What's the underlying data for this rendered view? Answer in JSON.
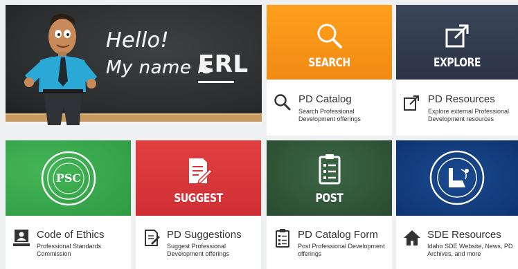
{
  "hero": {
    "line1": "Hello!",
    "line2": "My name is",
    "name": "ERL"
  },
  "tiles": [
    {
      "label": "SEARCH",
      "color": "#f7901e",
      "icon": "magnifier-icon"
    },
    {
      "label": "EXPLORE",
      "color": "#2f3b4e",
      "icon": "external-link-icon"
    },
    {
      "label": "",
      "color": "#37a64a",
      "icon": "psc-seal-icon",
      "seal_text": "PSC"
    },
    {
      "label": "SUGGEST",
      "color": "#d9353a",
      "icon": "document-pen-icon"
    },
    {
      "label": "POST",
      "color": "#2f5537",
      "icon": "clipboard-list-icon"
    },
    {
      "label": "",
      "color": "#0f3a7a",
      "icon": "department-of-education-seal-icon"
    }
  ],
  "cards": [
    {
      "title": "PD Catalog",
      "desc": "Search Professional Development offerings",
      "icon": "search-icon"
    },
    {
      "title": "PD Resources",
      "desc": "Explore external Professional Development resources",
      "icon": "external-link-icon"
    },
    {
      "title": "Code of Ethics",
      "desc": "Professional Standards Commission",
      "icon": "ethics-badge-icon"
    },
    {
      "title": "PD Suggestions",
      "desc": "Suggest Professional Development offerings",
      "icon": "document-pen-icon"
    },
    {
      "title": "PD Catalog Form",
      "desc": "Post Professional Development offerings",
      "icon": "clipboard-list-icon"
    },
    {
      "title": "SDE Resources",
      "desc": "Idaho SDE Website, News, PD Archives, and more",
      "icon": "home-icon"
    }
  ]
}
